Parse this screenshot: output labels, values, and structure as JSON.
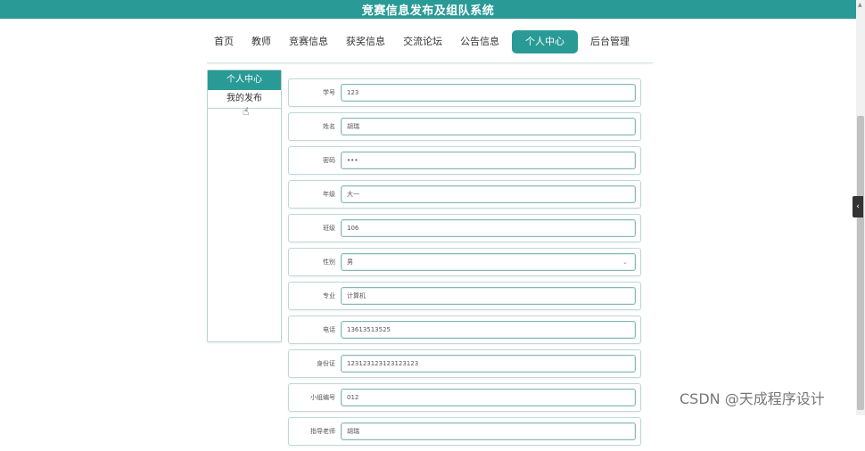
{
  "header": {
    "title": "竞赛信息发布及组队系统"
  },
  "nav": {
    "items": [
      {
        "label": "首页"
      },
      {
        "label": "教师"
      },
      {
        "label": "竞赛信息"
      },
      {
        "label": "获奖信息"
      },
      {
        "label": "交流论坛"
      },
      {
        "label": "公告信息"
      },
      {
        "label": "个人中心",
        "active": true
      },
      {
        "label": "后台管理"
      }
    ]
  },
  "sidebar": {
    "title": "个人中心",
    "link": "我的发布"
  },
  "form": {
    "fields": [
      {
        "label": "学号",
        "value": "123"
      },
      {
        "label": "姓名",
        "value": "胡瑞"
      },
      {
        "label": "密码",
        "value": "•••"
      },
      {
        "label": "年级",
        "value": "大一"
      },
      {
        "label": "班级",
        "value": "106"
      },
      {
        "label": "性别",
        "value": "男"
      },
      {
        "label": "专业",
        "value": "计算机"
      },
      {
        "label": "电话",
        "value": "13613513525"
      },
      {
        "label": "身份证",
        "value": "123123123123123123"
      },
      {
        "label": "小组编号",
        "value": "012"
      },
      {
        "label": "指导老师",
        "value": "胡瑞"
      }
    ]
  },
  "side_tab": {
    "label": "‹"
  },
  "watermark": "CSDN @天成程序设计",
  "colors": {
    "accent": "#2a9a96"
  }
}
